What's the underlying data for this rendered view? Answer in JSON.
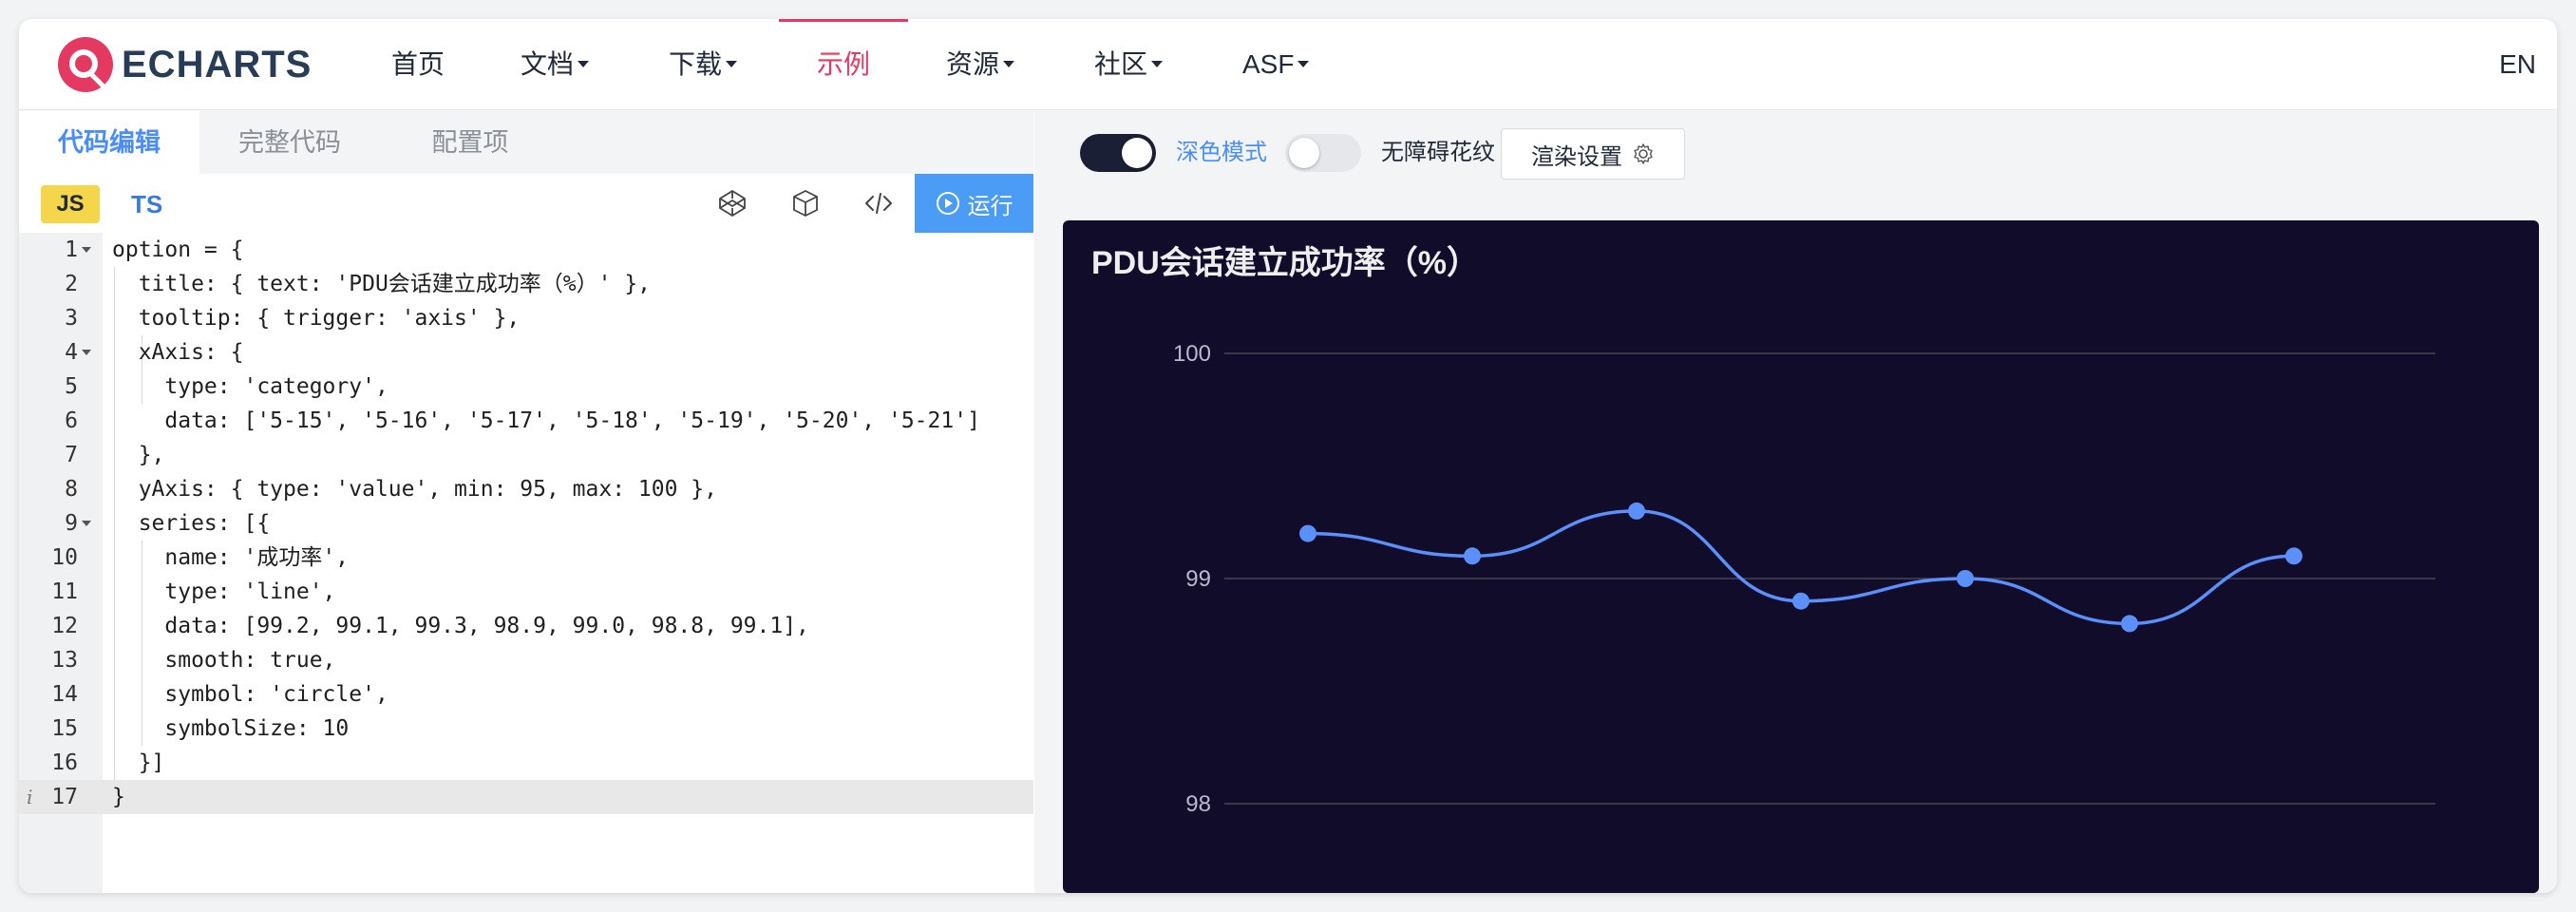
{
  "nav": {
    "logo_text": "ECHARTS",
    "items": [
      {
        "label": "首页",
        "caret": false,
        "active": false
      },
      {
        "label": "文档",
        "caret": true,
        "active": false
      },
      {
        "label": "下载",
        "caret": true,
        "active": false
      },
      {
        "label": "示例",
        "caret": false,
        "active": true
      },
      {
        "label": "资源",
        "caret": true,
        "active": false
      },
      {
        "label": "社区",
        "caret": true,
        "active": false
      },
      {
        "label": "ASF",
        "caret": true,
        "active": false
      }
    ],
    "lang": "EN",
    "accent_color": "#e43961"
  },
  "editor_panel": {
    "tabs": [
      "代码编辑",
      "完整代码",
      "配置项"
    ],
    "active_tab": 0,
    "lang_js": "JS",
    "lang_ts": "TS",
    "tool_icons": [
      "codepen-icon",
      "box-icon",
      "code-icon"
    ],
    "run_label": "运行",
    "code_lines": [
      "option = {",
      "  title: { text: 'PDU会话建立成功率（%）' },",
      "  tooltip: { trigger: 'axis' },",
      "  xAxis: {",
      "    type: 'category',",
      "    data: ['5-15', '5-16', '5-17', '5-18', '5-19', '5-20', '5-21']",
      "  },",
      "  yAxis: { type: 'value', min: 95, max: 100 },",
      "  series: [{",
      "    name: '成功率',",
      "    type: 'line',",
      "    data: [99.2, 99.1, 99.3, 98.9, 99.0, 98.8, 99.1],",
      "    smooth: true,",
      "    symbol: 'circle',",
      "    symbolSize: 10",
      "  }]",
      "}"
    ],
    "current_line": 17
  },
  "preview_panel": {
    "dark_mode_label": "深色模式",
    "dark_mode_on": true,
    "aria_label": "无障碍花纹",
    "aria_on": false,
    "render_settings_label": "渲染设置",
    "chart_background": "#100c2a",
    "line_color": "#5b8ff9"
  },
  "chart_data": {
    "type": "line",
    "title": "PDU会话建立成功率（%）",
    "categories": [
      "5-15",
      "5-16",
      "5-17",
      "5-18",
      "5-19",
      "5-20",
      "5-21"
    ],
    "series": [
      {
        "name": "成功率",
        "values": [
          99.2,
          99.1,
          99.3,
          98.9,
          99.0,
          98.8,
          99.1
        ]
      }
    ],
    "ylim": [
      95,
      100
    ],
    "visible_y_ticks": [
      "100",
      "99",
      "98"
    ],
    "smooth": true,
    "grid": true
  }
}
